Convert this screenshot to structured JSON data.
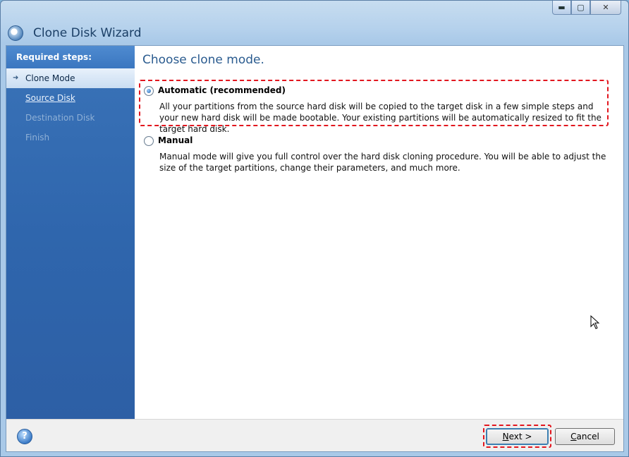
{
  "window": {
    "title": "Clone Disk Wizard",
    "controls": {
      "minimize": "▬",
      "maximize": "▢",
      "close": "✕"
    }
  },
  "sidebar": {
    "header": "Required steps:",
    "items": [
      {
        "label": "Clone Mode",
        "state": "active"
      },
      {
        "label": "Source Disk",
        "state": "link"
      },
      {
        "label": "Destination Disk",
        "state": "disabled"
      },
      {
        "label": "Finish",
        "state": "disabled"
      }
    ]
  },
  "main": {
    "title": "Choose clone mode.",
    "options": [
      {
        "label": "Automatic (recommended)",
        "selected": true,
        "description": "All your partitions from the source hard disk will be copied to the target disk in a few simple steps and your new hard disk will be made bootable. Your existing partitions will be automatically resized to fit the target hard disk."
      },
      {
        "label": "Manual",
        "selected": false,
        "description": "Manual mode will give you full control over the hard disk cloning procedure. You will be able to adjust the size of the target partitions, change their parameters, and much more."
      }
    ]
  },
  "footer": {
    "help_glyph": "?",
    "next": {
      "mnemonic": "N",
      "rest": "ext >"
    },
    "cancel": {
      "mnemonic": "C",
      "rest": "ancel"
    }
  },
  "colors": {
    "highlight": "#e2161e",
    "sidebar": "#2f66ad",
    "title_text": "#2a5b8f"
  }
}
